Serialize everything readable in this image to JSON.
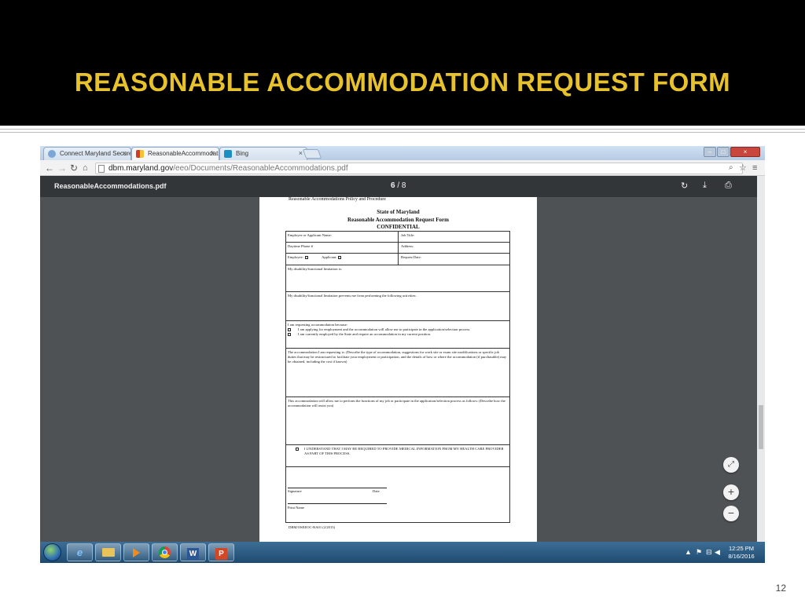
{
  "slide": {
    "title": "REASONABLE ACCOMMODATION REQUEST FORM",
    "number": "12",
    "colors": {
      "header_bg": "#000000",
      "title_color": "#e8c22c"
    }
  },
  "browser": {
    "tabs": [
      {
        "label": "Connect Maryland Secure",
        "icon": "globe-icon",
        "active": false
      },
      {
        "label": "ReasonableAccommodati",
        "icon": "maryland-flag-icon",
        "active": true
      },
      {
        "label": "Bing",
        "icon": "bing-icon",
        "active": false
      }
    ],
    "url_host": "dbm.maryland.gov",
    "url_path": "/eeo/Documents/ReasonableAccommodations.pdf"
  },
  "pdf_viewer": {
    "filename": "ReasonableAccommodations.pdf",
    "current_page": "6",
    "total_pages": "/ 8"
  },
  "document": {
    "running_header": "Reasonable Accommodations Policy and Procedure",
    "title_line1": "State of Maryland",
    "title_line2": "Reasonable Accommodation Request Form",
    "title_line3": "CONFIDENTIAL",
    "fields": {
      "employee_name": "Employee or Applicant Name:",
      "job_title": "Job Title:",
      "daytime_phone": "Daytime Phone #",
      "address": "Address:",
      "employee": "Employee:",
      "applicant": "Applicant:",
      "request_date": "Request Date:"
    },
    "disability": "My disability/functional limitation is:",
    "prevents": "My disability/functional limitation prevents me from performing the following activities:",
    "requesting_intro": "I am requesting accommodation because:",
    "requesting_opt1": "I am applying for employment and the accommodation will allow me to participate in the application/selection process",
    "requesting_opt2": "I am currently employed by the State and require an accommodation in my current position.",
    "accommodation_desc": "The accommodation I am requesting is: (Describe the type of accommodation, suggestions for work site or exam site modifications or specific job duties that may be restructured to facilitate your employment or participation, and the details of how or where the accommodation (if purchasable) may be obtained, including the cost if known)",
    "allow_desc": "This accommodation will allow me to perform the functions of my job or participate in the application/selection process as follows: (Describe how the accommodation will assist you)",
    "medical_ack": "I UNDERSTAND THAT I MAY BE REQUIRED TO PROVIDE MEDICAL INFORMATION FROM MY HEALTH CARE PROVIDER AS PART OF THIS PROCESS.",
    "signature": "Signature",
    "date": "Date",
    "print_name": "Print Name",
    "form_code": "DBM/OSEEOC-RA01 (2/2015)"
  },
  "taskbar": {
    "apps": [
      "internet-explorer-icon",
      "file-explorer-icon",
      "media-player-icon",
      "chrome-icon",
      "word-icon",
      "powerpoint-icon"
    ],
    "clock_time": "12:25 PM",
    "clock_date": "8/16/2016"
  }
}
